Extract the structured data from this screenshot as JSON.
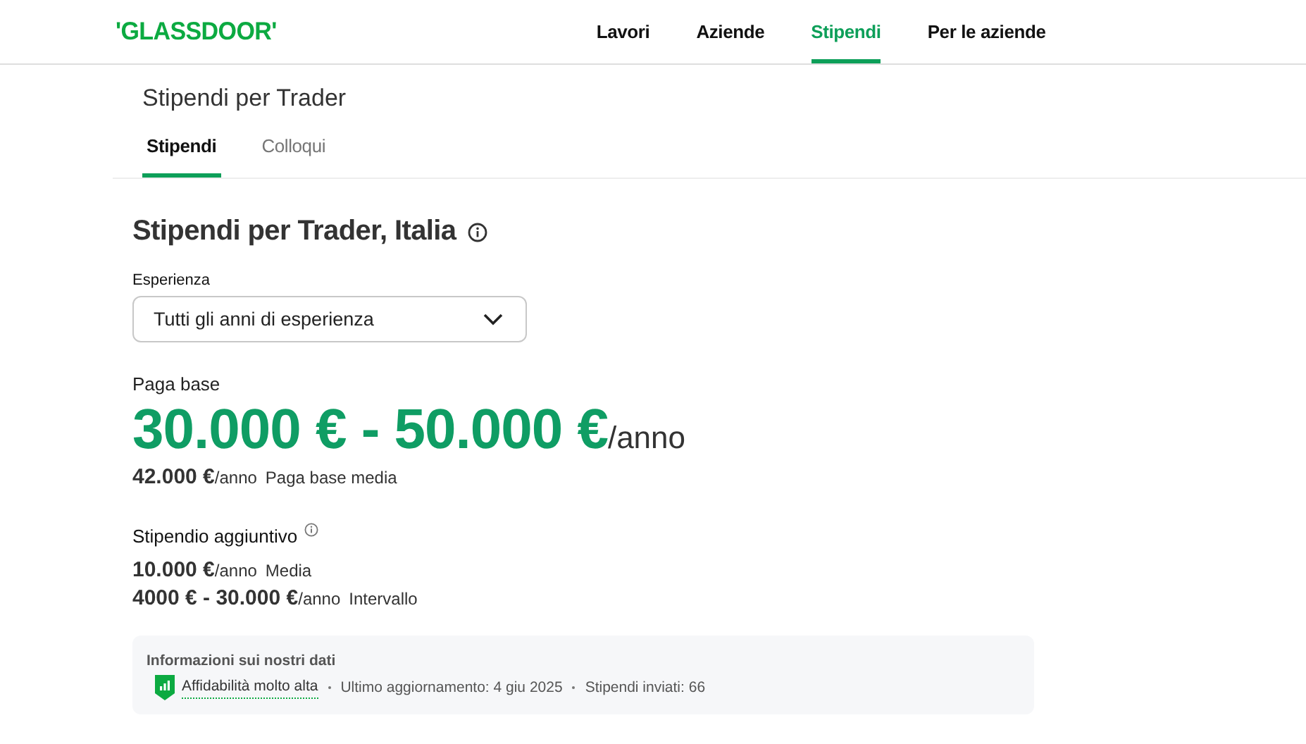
{
  "header": {
    "logo": "'GLASSDOOR'",
    "nav": [
      {
        "label": "Lavori",
        "selected": false
      },
      {
        "label": "Aziende",
        "selected": false
      },
      {
        "label": "Stipendi",
        "selected": true
      },
      {
        "label": "Per le aziende",
        "selected": false
      }
    ]
  },
  "subheader": {
    "title": "Stipendi per Trader",
    "tabs": [
      {
        "label": "Stipendi",
        "selected": true
      },
      {
        "label": "Colloqui",
        "selected": false
      }
    ]
  },
  "main": {
    "title": "Stipendi per Trader, Italia",
    "experience": {
      "label": "Esperienza",
      "value": "Tutti gli anni di esperienza"
    },
    "base_pay": {
      "label": "Paga base",
      "range": "30.000 € - 50.000 €",
      "unit": "/anno",
      "average": "42.000 €",
      "average_unit": "/anno",
      "average_label": "Paga base media"
    },
    "additional_pay": {
      "label": "Stipendio aggiuntivo",
      "rows": [
        {
          "amount": "10.000 €",
          "unit": "/anno",
          "label": "Media"
        },
        {
          "amount": "4000 € - 30.000 €",
          "unit": "/anno",
          "label": "Intervallo"
        }
      ]
    },
    "data_info": {
      "title": "Informazioni sui nostri dati",
      "confidence": "Affidabilità molto alta",
      "updated": "Ultimo aggiornamento: 4 giu 2025",
      "submitted": "Stipendi inviati: 66"
    }
  }
}
